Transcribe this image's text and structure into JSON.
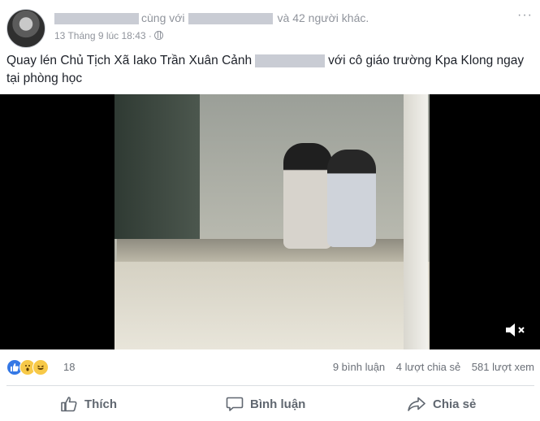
{
  "header": {
    "with_text": "cùng với",
    "others_text": "và 42 người khác.",
    "timestamp": "13 Tháng 9 lúc 18:43",
    "separator": "·",
    "more_label": "···"
  },
  "caption": {
    "before": "Quay lén Chủ Tịch Xã Iako Trần Xuân Cảnh",
    "after": "với cô giáo trường Kpa Klong ngay tại phòng học"
  },
  "video": {
    "mute_icon": "speaker-muted-icon"
  },
  "stats": {
    "reaction_count": "18",
    "comments": "9 bình luận",
    "shares": "4 lượt chia sẻ",
    "views": "581 lượt xem",
    "reaction_icons": [
      "like-icon",
      "wow-icon",
      "haha-icon"
    ]
  },
  "actions": {
    "like": "Thích",
    "comment": "Bình luận",
    "share": "Chia sẻ"
  },
  "colors": {
    "text": "#1d2129",
    "meta": "#90949c",
    "action": "#606770",
    "like_blue": "#3578e5",
    "reaction_yellow": "#f7c948"
  }
}
